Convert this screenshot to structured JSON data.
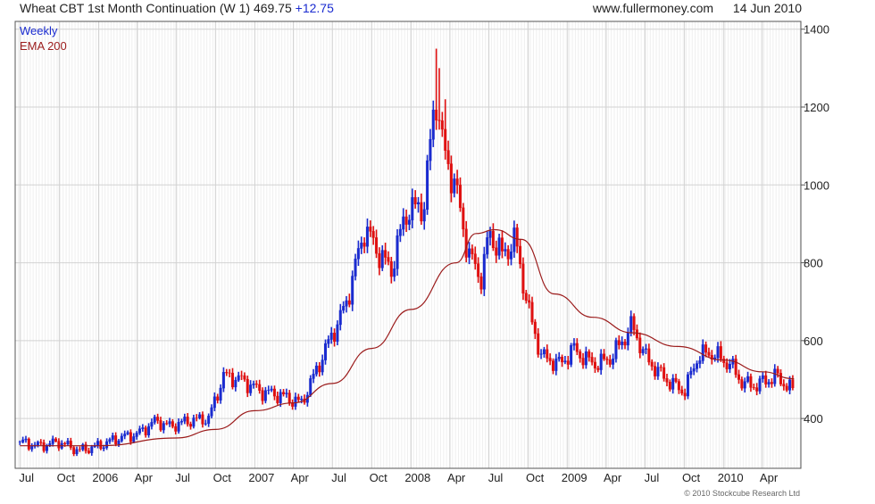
{
  "header": {
    "title": "Wheat CBT 1st Month Continuation (W 1) 469.75",
    "change": "+12.75",
    "site": "www.fullermoney.com",
    "date": "14 Jun 2010"
  },
  "footer": {
    "copyright": "© 2010 Stockcube Research Ltd"
  },
  "colors": {
    "up": "#1a2bd0",
    "down": "#e01010",
    "ema": "#9b1b1b",
    "grid": "#d2d2d2",
    "frame": "#555555"
  },
  "chart_data": {
    "type": "candlestick",
    "legend": [
      "Weekly",
      "EMA 200"
    ],
    "legend_position": "top-left",
    "grid": true,
    "x_tick_labels": [
      "Jul",
      "Oct",
      "2006",
      "Apr",
      "Jul",
      "Oct",
      "2007",
      "Apr",
      "Jul",
      "Oct",
      "2008",
      "Apr",
      "Jul",
      "Oct",
      "2009",
      "Apr",
      "Jul",
      "Oct",
      "2010",
      "Apr"
    ],
    "y_ticks": [
      400,
      600,
      800,
      1000,
      1200,
      1400
    ],
    "y_tick_labels": [
      "400",
      "600",
      "800",
      "1000",
      "1200",
      "1400"
    ],
    "ylim": [
      272,
      1420
    ],
    "xlim": [
      "2005-06-20",
      "2010-06-30"
    ],
    "price_points": [
      [
        "2005-07-01",
        340
      ],
      [
        "2005-08-15",
        330
      ],
      [
        "2005-10-01",
        340
      ],
      [
        "2005-11-15",
        318
      ],
      [
        "2006-01-01",
        330
      ],
      [
        "2006-02-15",
        350
      ],
      [
        "2006-04-01",
        360
      ],
      [
        "2006-05-15",
        395
      ],
      [
        "2006-06-15",
        380
      ],
      [
        "2006-08-01",
        395
      ],
      [
        "2006-09-15",
        400
      ],
      [
        "2006-10-20",
        510
      ],
      [
        "2006-12-01",
        500
      ],
      [
        "2007-01-15",
        470
      ],
      [
        "2007-03-01",
        460
      ],
      [
        "2007-04-20",
        440
      ],
      [
        "2007-05-15",
        500
      ],
      [
        "2007-06-20",
        590
      ],
      [
        "2007-08-01",
        690
      ],
      [
        "2007-09-15",
        890
      ],
      [
        "2007-10-15",
        830
      ],
      [
        "2007-11-15",
        780
      ],
      [
        "2007-12-20",
        930
      ],
      [
        "2008-02-01",
        950
      ],
      [
        "2008-02-27",
        1240
      ],
      [
        "2008-03-15",
        1100
      ],
      [
        "2008-04-15",
        990
      ],
      [
        "2008-05-15",
        820
      ],
      [
        "2008-06-15",
        760
      ],
      [
        "2008-07-01",
        880
      ],
      [
        "2008-08-01",
        820
      ],
      [
        "2008-09-01",
        860
      ],
      [
        "2008-10-01",
        680
      ],
      [
        "2008-11-01",
        560
      ],
      [
        "2008-12-15",
        540
      ],
      [
        "2009-01-15",
        580
      ],
      [
        "2009-02-15",
        550
      ],
      [
        "2009-03-15",
        540
      ],
      [
        "2009-04-15",
        560
      ],
      [
        "2009-06-01",
        640
      ],
      [
        "2009-07-01",
        560
      ],
      [
        "2009-08-01",
        520
      ],
      [
        "2009-09-01",
        490
      ],
      [
        "2009-10-01",
        470
      ],
      [
        "2009-11-01",
        560
      ],
      [
        "2009-12-01",
        570
      ],
      [
        "2010-01-15",
        540
      ],
      [
        "2010-02-15",
        490
      ],
      [
        "2010-03-15",
        485
      ],
      [
        "2010-04-15",
        500
      ],
      [
        "2010-05-01",
        510
      ],
      [
        "2010-06-14",
        470
      ]
    ],
    "spike_highs": [
      [
        "2008-02-27",
        1350
      ],
      [
        "2008-03-05",
        1300
      ],
      [
        "2008-03-19",
        1220
      ]
    ],
    "ema_200": [
      [
        "2005-07-01",
        330
      ],
      [
        "2006-01-01",
        330
      ],
      [
        "2006-07-01",
        350
      ],
      [
        "2006-10-01",
        372
      ],
      [
        "2007-01-01",
        420
      ],
      [
        "2007-04-01",
        440
      ],
      [
        "2007-07-01",
        490
      ],
      [
        "2007-10-01",
        580
      ],
      [
        "2008-01-01",
        680
      ],
      [
        "2008-04-15",
        800
      ],
      [
        "2008-06-01",
        875
      ],
      [
        "2008-07-15",
        885
      ],
      [
        "2008-09-15",
        860
      ],
      [
        "2008-12-01",
        720
      ],
      [
        "2009-03-01",
        660
      ],
      [
        "2009-06-01",
        620
      ],
      [
        "2009-09-15",
        585
      ],
      [
        "2010-01-01",
        550
      ],
      [
        "2010-04-01",
        520
      ],
      [
        "2010-06-14",
        502
      ]
    ]
  }
}
